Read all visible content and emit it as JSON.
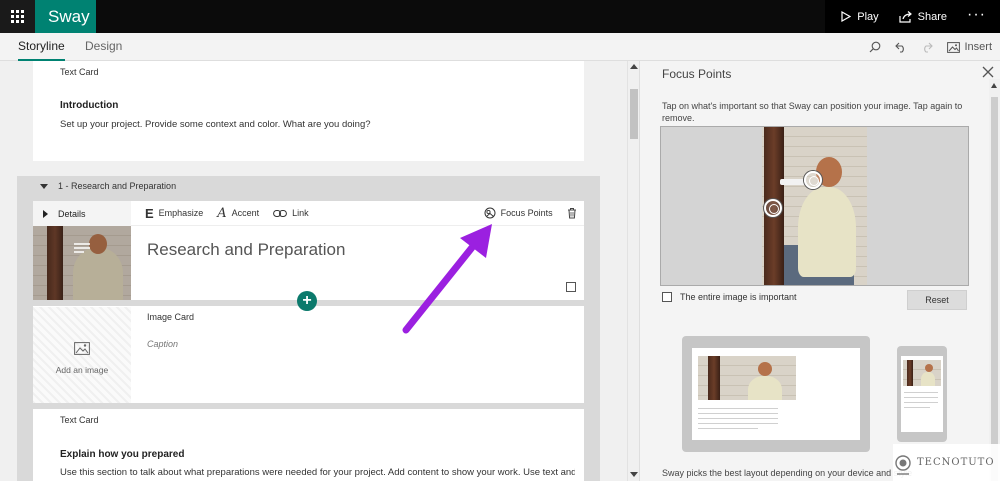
{
  "app": {
    "brand": "Sway",
    "play_label": "Play",
    "share_label": "Share",
    "more_label": "···"
  },
  "tabs": [
    {
      "label": "Storyline",
      "active": true
    },
    {
      "label": "Design",
      "active": false
    }
  ],
  "toolbar": {
    "insert_label": "Insert",
    "icons": [
      "search-icon",
      "undo-icon",
      "redo-icon",
      "insert-image-icon"
    ]
  },
  "storyline": {
    "intro_card": {
      "type": "Text Card",
      "heading": "Introduction",
      "body": "Set up your project. Provide some context and color.  What are you doing?"
    },
    "section": {
      "title": "1 - Research and Preparation",
      "details_label": "Details",
      "card_tools": {
        "emphasize": "Emphasize",
        "accent": "Accent",
        "link": "Link",
        "focus_points": "Focus Points"
      },
      "heading_text": "Research and Preparation",
      "image_card": {
        "type": "Image Card",
        "caption_placeholder": "Caption",
        "add_image_label": "Add an image"
      },
      "text_card": {
        "type": "Text Card",
        "heading": "Explain how you prepared",
        "body": "Use this section to talk about what preparations were needed for your project.  Add content to show your work.  Use text and"
      }
    }
  },
  "panel": {
    "title": "Focus Points",
    "description": "Tap on what's important so that Sway can position your image. Tap again to remove.",
    "entire_image_label": "The entire image is important",
    "entire_image_checked": false,
    "reset_label": "Reset",
    "footer_text": "Sway picks the best layout depending on your device and style"
  },
  "watermark": {
    "text": "TECNOTUTO"
  },
  "colors": {
    "brand_teal": "#008272",
    "arrow_purple": "#9b20e0",
    "topbar": "#0b0b0b"
  }
}
